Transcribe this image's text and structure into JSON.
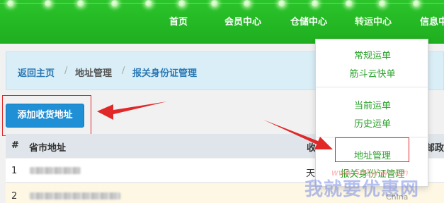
{
  "nav": {
    "items": [
      "首页",
      "会员中心",
      "仓储中心",
      "转运中心",
      "信息中"
    ]
  },
  "breadcrumb": {
    "home": "返回主页",
    "separator": "/",
    "address": "地址管理",
    "current": "报关身份证管理"
  },
  "toolbar": {
    "add_label": "添加收货地址"
  },
  "table": {
    "headers": {
      "index": "#",
      "province": "省市地址",
      "recipient": "收",
      "postcode": "邮政"
    },
    "rows": [
      {
        "index": "1",
        "recipient_fragment": "天"
      },
      {
        "index": "2",
        "recipient_fragment": ""
      }
    ]
  },
  "dropdown": {
    "items": [
      "常规运单",
      "筋斗云快单",
      "当前运单",
      "历史运单",
      "地址管理",
      "报关身份证管理"
    ]
  },
  "watermark": {
    "url": "www.591yhw.com",
    "text": "我就要优惠网",
    "country": "China"
  },
  "colors": {
    "nav_bg": "#1fae1f",
    "accent_blue": "#1f8fd6",
    "link_green": "#2aa12a",
    "annotation_red": "#e02828"
  }
}
